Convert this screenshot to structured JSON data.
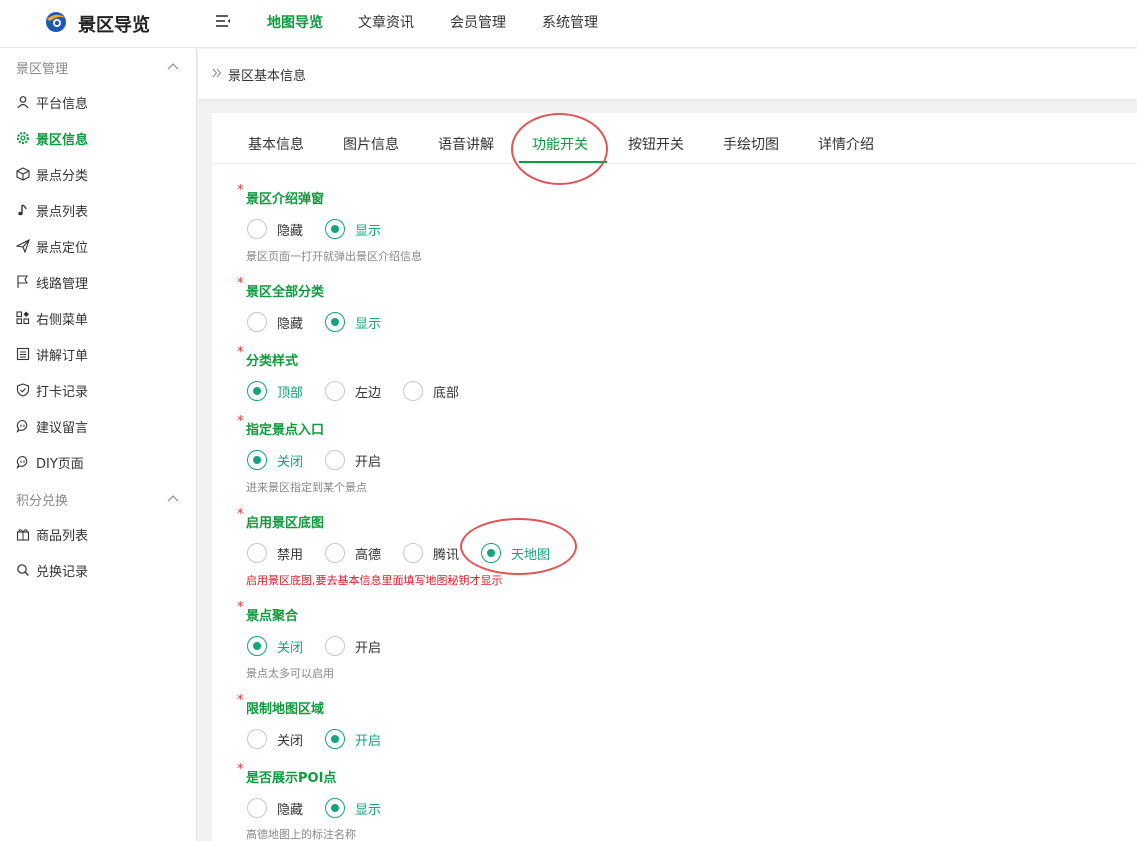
{
  "header": {
    "brand": "景区导览",
    "nav": [
      "地图导览",
      "文章资讯",
      "会员管理",
      "系统管理"
    ],
    "active_nav": "地图导览"
  },
  "sidebar": {
    "group1": "景区管理",
    "items1": [
      {
        "label": "平台信息",
        "icon": "user-icon"
      },
      {
        "label": "景区信息",
        "icon": "gear-icon",
        "active": true
      },
      {
        "label": "景点分类",
        "icon": "cube-icon"
      },
      {
        "label": "景点列表",
        "icon": "music-note-icon"
      },
      {
        "label": "景点定位",
        "icon": "send-icon"
      },
      {
        "label": "线路管理",
        "icon": "flag-icon"
      },
      {
        "label": "右侧菜单",
        "icon": "grid-icon"
      },
      {
        "label": "讲解订单",
        "icon": "list-icon"
      },
      {
        "label": "打卡记录",
        "icon": "shield-icon"
      },
      {
        "label": "建议留言",
        "icon": "comment-icon"
      },
      {
        "label": "DIY页面",
        "icon": "comment-icon"
      }
    ],
    "group2": "积分兑换",
    "items2": [
      {
        "label": "商品列表",
        "icon": "gift-icon"
      },
      {
        "label": "兑换记录",
        "icon": "search-icon"
      }
    ]
  },
  "breadcrumb": "景区基本信息",
  "tabs": [
    "基本信息",
    "图片信息",
    "语音讲解",
    "功能开关",
    "按钮开关",
    "手绘切图",
    "详情介绍"
  ],
  "active_tab": "功能开关",
  "fields": [
    {
      "label": "景区介绍弹窗",
      "options": [
        "隐藏",
        "显示"
      ],
      "selected": "显示",
      "hint": "景区页面一打开就弹出景区介绍信息"
    },
    {
      "label": "景区全部分类",
      "options": [
        "隐藏",
        "显示"
      ],
      "selected": "显示",
      "hint": ""
    },
    {
      "label": "分类样式",
      "options": [
        "顶部",
        "左边",
        "底部"
      ],
      "selected": "顶部",
      "hint": ""
    },
    {
      "label": "指定景点入口",
      "options": [
        "关闭",
        "开启"
      ],
      "selected": "关闭",
      "hint": "进来景区指定到某个景点"
    },
    {
      "label": "启用景区底图",
      "options": [
        "禁用",
        "高德",
        "腾讯",
        "天地图"
      ],
      "selected": "天地图",
      "hint": "启用景区底图,要去基本信息里面填写地图秘钥才显示"
    },
    {
      "label": "景点聚合",
      "options": [
        "关闭",
        "开启"
      ],
      "selected": "关闭",
      "hint": "景点太多可以启用"
    },
    {
      "label": "限制地图区域",
      "options": [
        "关闭",
        "开启"
      ],
      "selected": "开启",
      "hint": ""
    },
    {
      "label": "是否展示POI点",
      "options": [
        "隐藏",
        "显示"
      ],
      "selected": "显示",
      "hint": "高德地图上的标注名称"
    }
  ],
  "colors": {
    "brand": "#0f9a3e",
    "radio": "#14a37f",
    "warn": "#d8202a",
    "annotation": "#e05555"
  }
}
